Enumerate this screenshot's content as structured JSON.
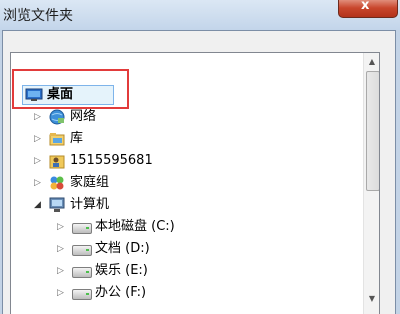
{
  "window": {
    "title": "浏览文件夹",
    "close_label": "x"
  },
  "tree": {
    "items": [
      {
        "label": "桌面",
        "icon": "desktop-icon",
        "arrow": ""
      },
      {
        "label": "网络",
        "icon": "network-icon",
        "arrow": "▷"
      },
      {
        "label": "库",
        "icon": "library-icon",
        "arrow": "▷"
      },
      {
        "label": "1515595681",
        "icon": "user-folder-icon",
        "arrow": "▷"
      },
      {
        "label": "家庭组",
        "icon": "homegroup-icon",
        "arrow": "▷"
      },
      {
        "label": "计算机",
        "icon": "computer-icon",
        "arrow": "◢"
      },
      {
        "label": "本地磁盘 (C:)",
        "icon": "drive-icon",
        "arrow": "▷"
      },
      {
        "label": "文档 (D:)",
        "icon": "drive-icon",
        "arrow": "▷"
      },
      {
        "label": "娱乐 (E:)",
        "icon": "drive-icon",
        "arrow": "▷"
      },
      {
        "label": "办公 (F:)",
        "icon": "drive-icon",
        "arrow": "▷"
      }
    ]
  },
  "scrollbar": {
    "up": "▲",
    "down": "▼"
  },
  "colors": {
    "highlight": "#e23b3b",
    "selection": "#e5f3fb"
  }
}
